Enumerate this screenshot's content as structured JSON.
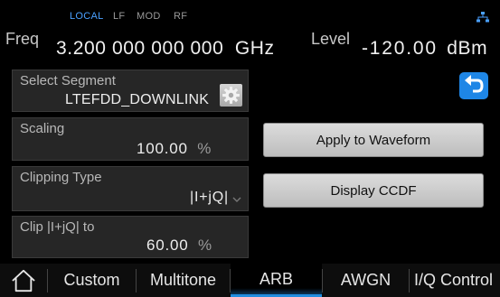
{
  "status": {
    "local": "LOCAL",
    "lf": "LF",
    "mod": "MOD",
    "rf": "RF",
    "network_icon": "network-icon"
  },
  "freq": {
    "label": "Freq",
    "value": "3.200 000 000 000",
    "unit": "GHz"
  },
  "level": {
    "label": "Level",
    "value": "-120.00",
    "unit": "dBm"
  },
  "segment": {
    "title": "Select Segment",
    "value": "LTEFDD_DOWNLINK",
    "settings_icon": "gear-icon"
  },
  "scaling": {
    "title": "Scaling",
    "value": "100.00",
    "unit": "%"
  },
  "clipping_type": {
    "title": "Clipping Type",
    "value": "|I+jQ|",
    "dropdown_icon": "chevron-down-icon"
  },
  "clip_to": {
    "title": "Clip |I+jQ| to",
    "value": "60.00",
    "unit": "%"
  },
  "buttons": {
    "apply": "Apply to Waveform",
    "ccdf": "Display CCDF",
    "back_icon": "back-arrow-icon"
  },
  "tabs": [
    {
      "label": "Custom"
    },
    {
      "label": "Multitone"
    },
    {
      "label": "ARB",
      "active": true
    },
    {
      "label": "AWGN"
    },
    {
      "label": "I/Q Control"
    }
  ],
  "home_icon": "home-icon",
  "colors": {
    "accent": "#4aa0ff",
    "active_tab": "#1f8ee0",
    "panel": "#262626",
    "button": "#d0d0d0"
  }
}
